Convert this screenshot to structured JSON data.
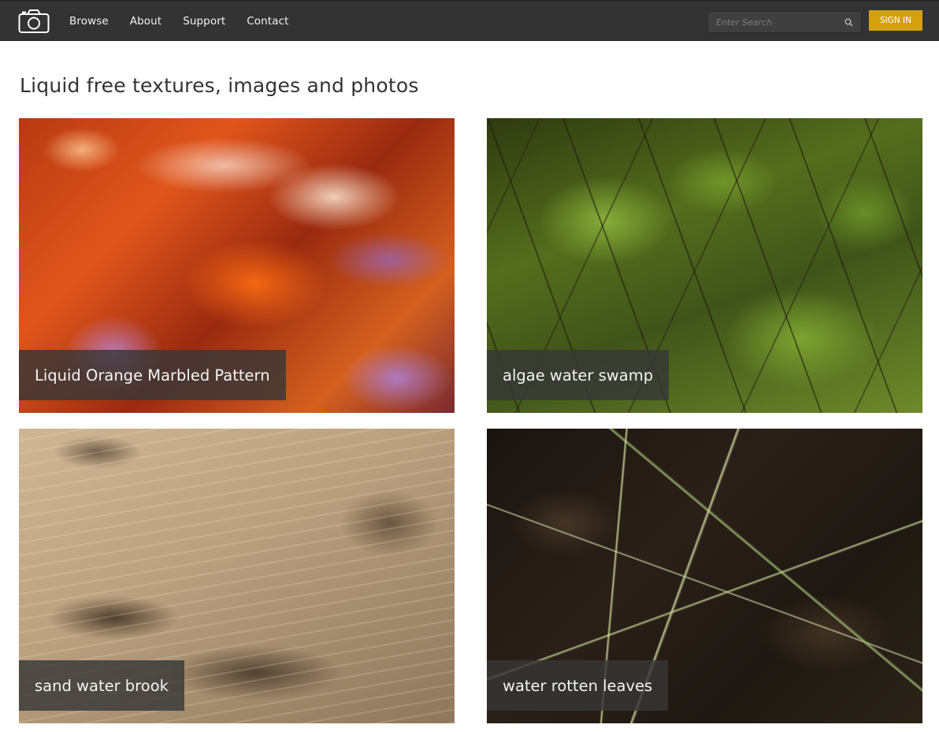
{
  "header": {
    "logo_icon": "camera-icon",
    "nav": [
      {
        "label": "Browse"
      },
      {
        "label": "About"
      },
      {
        "label": "Support"
      },
      {
        "label": "Contact"
      }
    ],
    "search": {
      "placeholder": "Enter Search",
      "icon": "search-icon"
    },
    "signin_label": "SIGN IN",
    "signin_color": "#d4a00f",
    "bar_color": "#333333"
  },
  "main": {
    "title": "Liquid free textures, images and photos",
    "cards": [
      {
        "caption": "Liquid Orange Marbled Pattern"
      },
      {
        "caption": "algae water swamp"
      },
      {
        "caption": "sand water brook"
      },
      {
        "caption": "water rotten leaves"
      }
    ]
  }
}
